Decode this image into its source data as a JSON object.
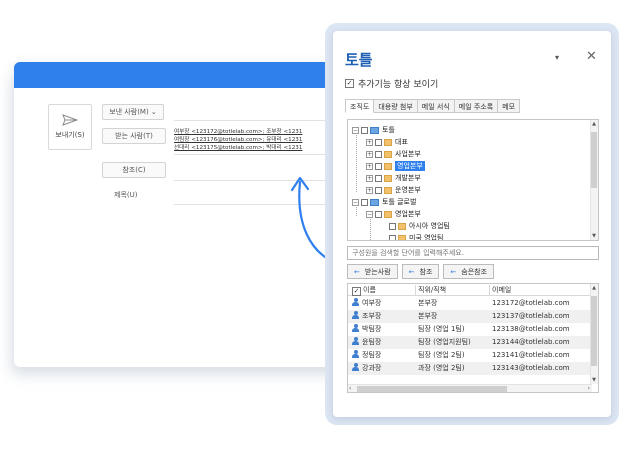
{
  "composer": {
    "send_label": "보내기(S)",
    "from_label": "보낸 사람(M) ⌄",
    "to_label": "받는 사람(T)",
    "cc_label": "참조(C)",
    "subject_label": "제목(U)",
    "recipients": [
      {
        "text": "여부장 <123172@totlelab.com>; 조부장 <1231"
      },
      {
        "text": "여팀장 <123176@totlelab.com>; 유대리 <1231"
      },
      {
        "text": "선대리 <123175@totlelab.com>; 박대리 <1231"
      }
    ]
  },
  "panel": {
    "title": "토틀",
    "dropdown_icon": "▾",
    "close_icon": "✕",
    "always_show_label": "추가기능 항상 보이기",
    "tabs": [
      "조직도",
      "대용량 첨부",
      "메일 서식",
      "메일 주소록",
      "메모"
    ],
    "tree": [
      {
        "label": "토틀",
        "level": 0,
        "expander": "−",
        "icon": "org"
      },
      {
        "label": "대표",
        "level": 1,
        "expander": "+",
        "icon": "folder"
      },
      {
        "label": "사업본부",
        "level": 1,
        "expander": "+",
        "icon": "folder"
      },
      {
        "label": "영업본부",
        "level": 1,
        "expander": "+",
        "icon": "folder",
        "selected": true
      },
      {
        "label": "개발본부",
        "level": 1,
        "expander": "+",
        "icon": "folder"
      },
      {
        "label": "운영본부",
        "level": 1,
        "expander": "+",
        "icon": "folder"
      },
      {
        "label": "토틀 글로벌",
        "level": 0,
        "expander": "−",
        "icon": "org"
      },
      {
        "label": "영업본부",
        "level": 1,
        "expander": "−",
        "icon": "folder"
      },
      {
        "label": "아시아 영업팀",
        "level": 2,
        "expander": "",
        "icon": "folder"
      },
      {
        "label": "미국 영업팀",
        "level": 2,
        "expander": "",
        "icon": "folder"
      }
    ],
    "search_placeholder": "구성원을 검색할 단어를 입력해주세요.",
    "add_buttons": [
      {
        "label": "받는사람",
        "arrow": "←"
      },
      {
        "label": "참조",
        "arrow": "←"
      },
      {
        "label": "숨은참조",
        "arrow": "←"
      }
    ],
    "grid": {
      "headers": [
        "이름",
        "직위/직책",
        "이메일"
      ],
      "rows": [
        {
          "name": "여부장",
          "title": "본부장",
          "email": "123172@totlelab.com"
        },
        {
          "name": "조부장",
          "title": "본부장",
          "email": "123137@totlelab.com"
        },
        {
          "name": "박팀장",
          "title": "팀장 (영업 1팀)",
          "email": "123138@totlelab.com"
        },
        {
          "name": "윤팀장",
          "title": "팀장 (영업지원팀)",
          "email": "123144@totlelab.com"
        },
        {
          "name": "정팀장",
          "title": "팀장 (영업 2팀)",
          "email": "123141@totlelab.com"
        },
        {
          "name": "강과장",
          "title": "과장 (영업 2팀)",
          "email": "123143@totlelab.com"
        }
      ]
    }
  },
  "colors": {
    "accent": "#2f80ed",
    "title": "#1f5fb4",
    "folder": "#f2c26b"
  }
}
